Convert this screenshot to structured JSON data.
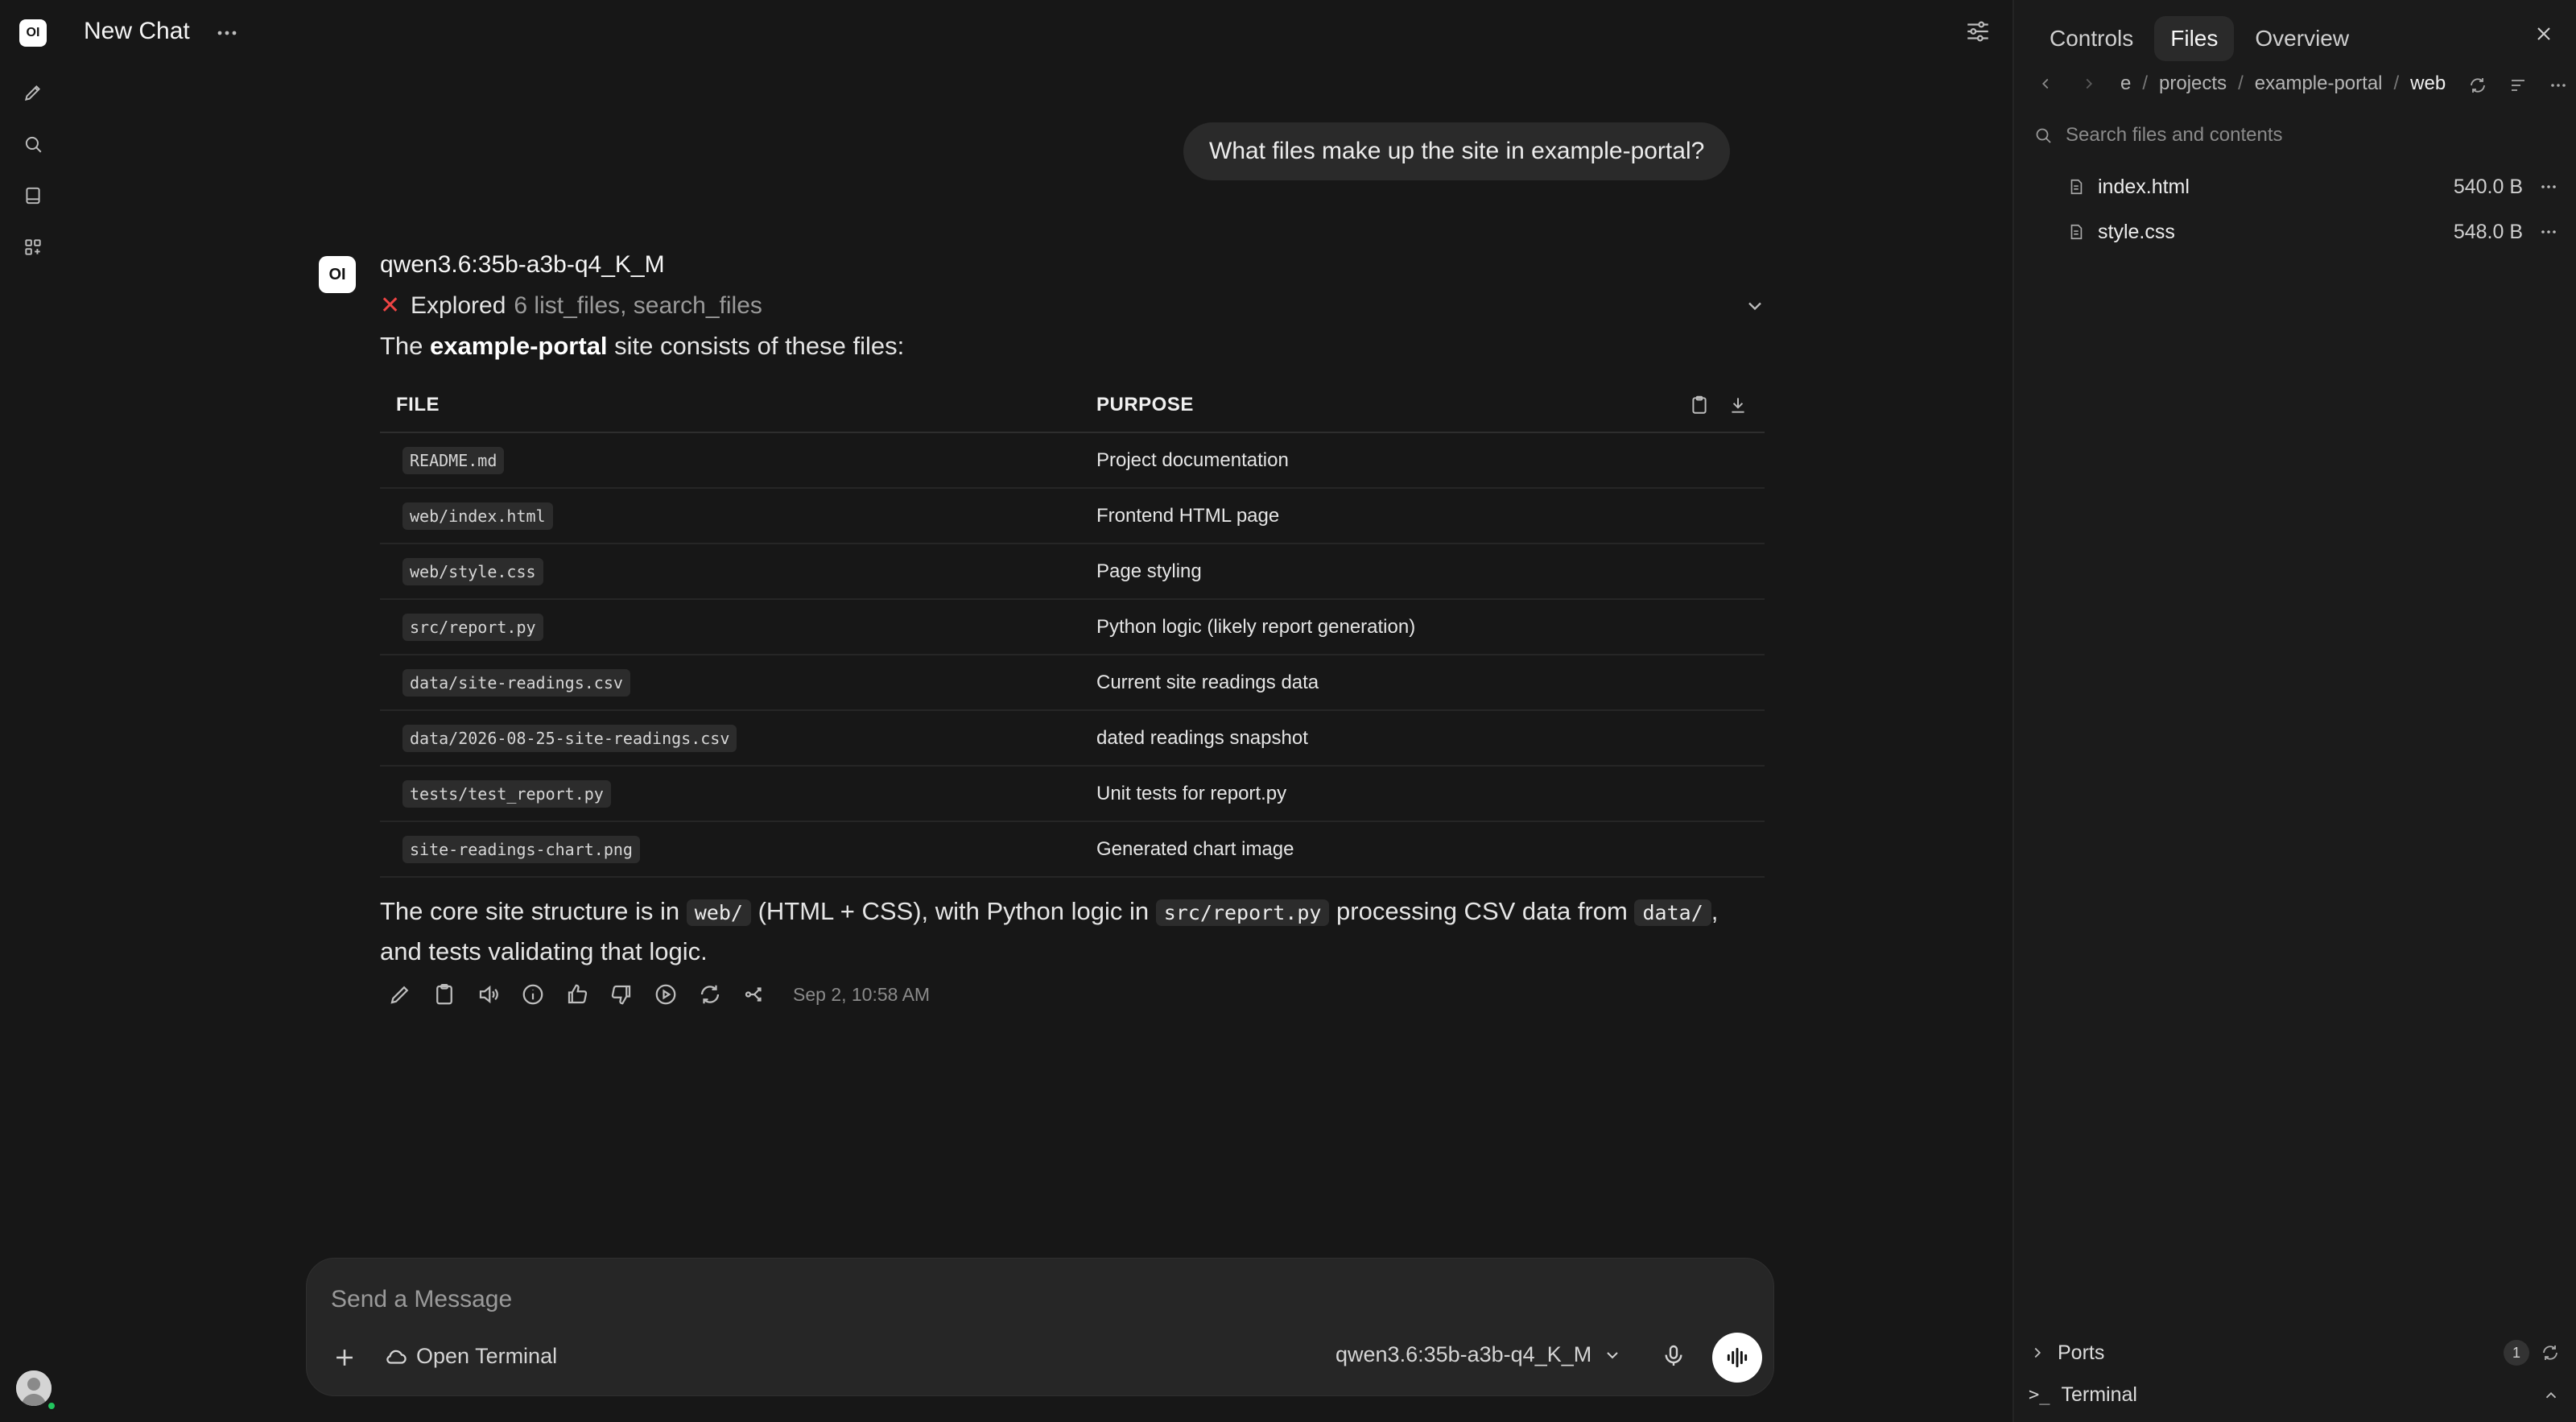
{
  "app": {
    "logo_text": "OI"
  },
  "header": {
    "title": "New Chat"
  },
  "conversation": {
    "user_message": "What files make up the site in example-portal?",
    "assistant": {
      "avatar_text": "OI",
      "model": "qwen3.6:35b-a3b-q4_K_M",
      "explored": {
        "verb": "Explored",
        "detail": "6 list_files, search_files"
      },
      "intro": {
        "before": "The ",
        "bold": "example-portal",
        "after": " site consists of these files:"
      },
      "table": {
        "headers": [
          "FILE",
          "PURPOSE"
        ],
        "rows": [
          {
            "file": "README.md",
            "purpose": "Project documentation"
          },
          {
            "file": "web/index.html",
            "purpose": "Frontend HTML page"
          },
          {
            "file": "web/style.css",
            "purpose": "Page styling"
          },
          {
            "file": "src/report.py",
            "purpose": "Python logic (likely report generation)"
          },
          {
            "file": "data/site-readings.csv",
            "purpose": "Current site readings data"
          },
          {
            "file": "data/2026-08-25-site-readings.csv",
            "purpose": "dated readings snapshot"
          },
          {
            "file": "tests/test_report.py",
            "purpose": "Unit tests for report.py"
          },
          {
            "file": "site-readings-chart.png",
            "purpose": "Generated chart image"
          }
        ]
      },
      "summary": {
        "t1": "The core site structure is in ",
        "c1": "web/",
        "t2": " (HTML + CSS), with Python logic in ",
        "c2": "src/report.py",
        "t3": " processing CSV data from ",
        "c3": "data/",
        "t4": ", and tests validating that logic."
      },
      "timestamp": "Sep 2, 10:58 AM"
    }
  },
  "composer": {
    "placeholder": "Send a Message",
    "terminal_label": "Open Terminal",
    "model_label": "qwen3.6:35b-a3b-q4_K_M"
  },
  "panel": {
    "tabs": [
      "Controls",
      "Files",
      "Overview"
    ],
    "active_tab": "Files",
    "breadcrumb": [
      "e",
      "projects",
      "example-portal",
      "web"
    ],
    "search_placeholder": "Search files and contents",
    "files": [
      {
        "name": "index.html",
        "size": "540.0 B"
      },
      {
        "name": "style.css",
        "size": "548.0 B"
      }
    ],
    "ports_label": "Ports",
    "ports_count": "1",
    "terminal_label": "Terminal"
  },
  "colors": {
    "background": "#171717",
    "panel": "#1b1b1b",
    "bubble": "#2a2a2a",
    "status_online": "#22c55e",
    "error_x": "#ef4444"
  }
}
